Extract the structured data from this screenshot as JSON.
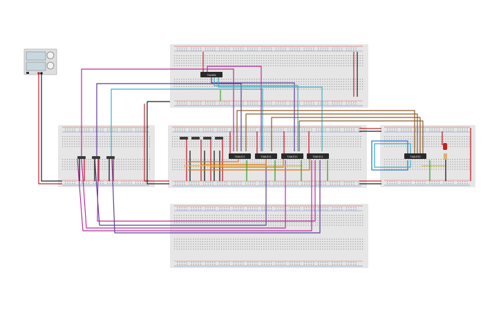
{
  "ics": {
    "top": "74LS04",
    "mid1": "74ALS11",
    "mid2": "74ALS11",
    "mid3": "74ALS11",
    "mid4": "74ALS11",
    "right": "74ALS32"
  },
  "colors": {
    "board": "#e6e6e6",
    "hole": "#9a9a9a",
    "rail_red": "#d93a3a",
    "rail_blue": "#4a6ed0",
    "wire_red": "#c8202a",
    "wire_black": "#1a1a1a",
    "wire_magenta": "#b82a9a",
    "wire_purple": "#5a3a9a",
    "wire_cyan": "#3aaec8",
    "wire_brown": "#8a5a2a",
    "wire_green": "#3aa02a",
    "wire_orange": "#e07a1a",
    "wire_yellow": "#e0c020",
    "wire_blue": "#2a7ad0",
    "led": "#c82020"
  }
}
